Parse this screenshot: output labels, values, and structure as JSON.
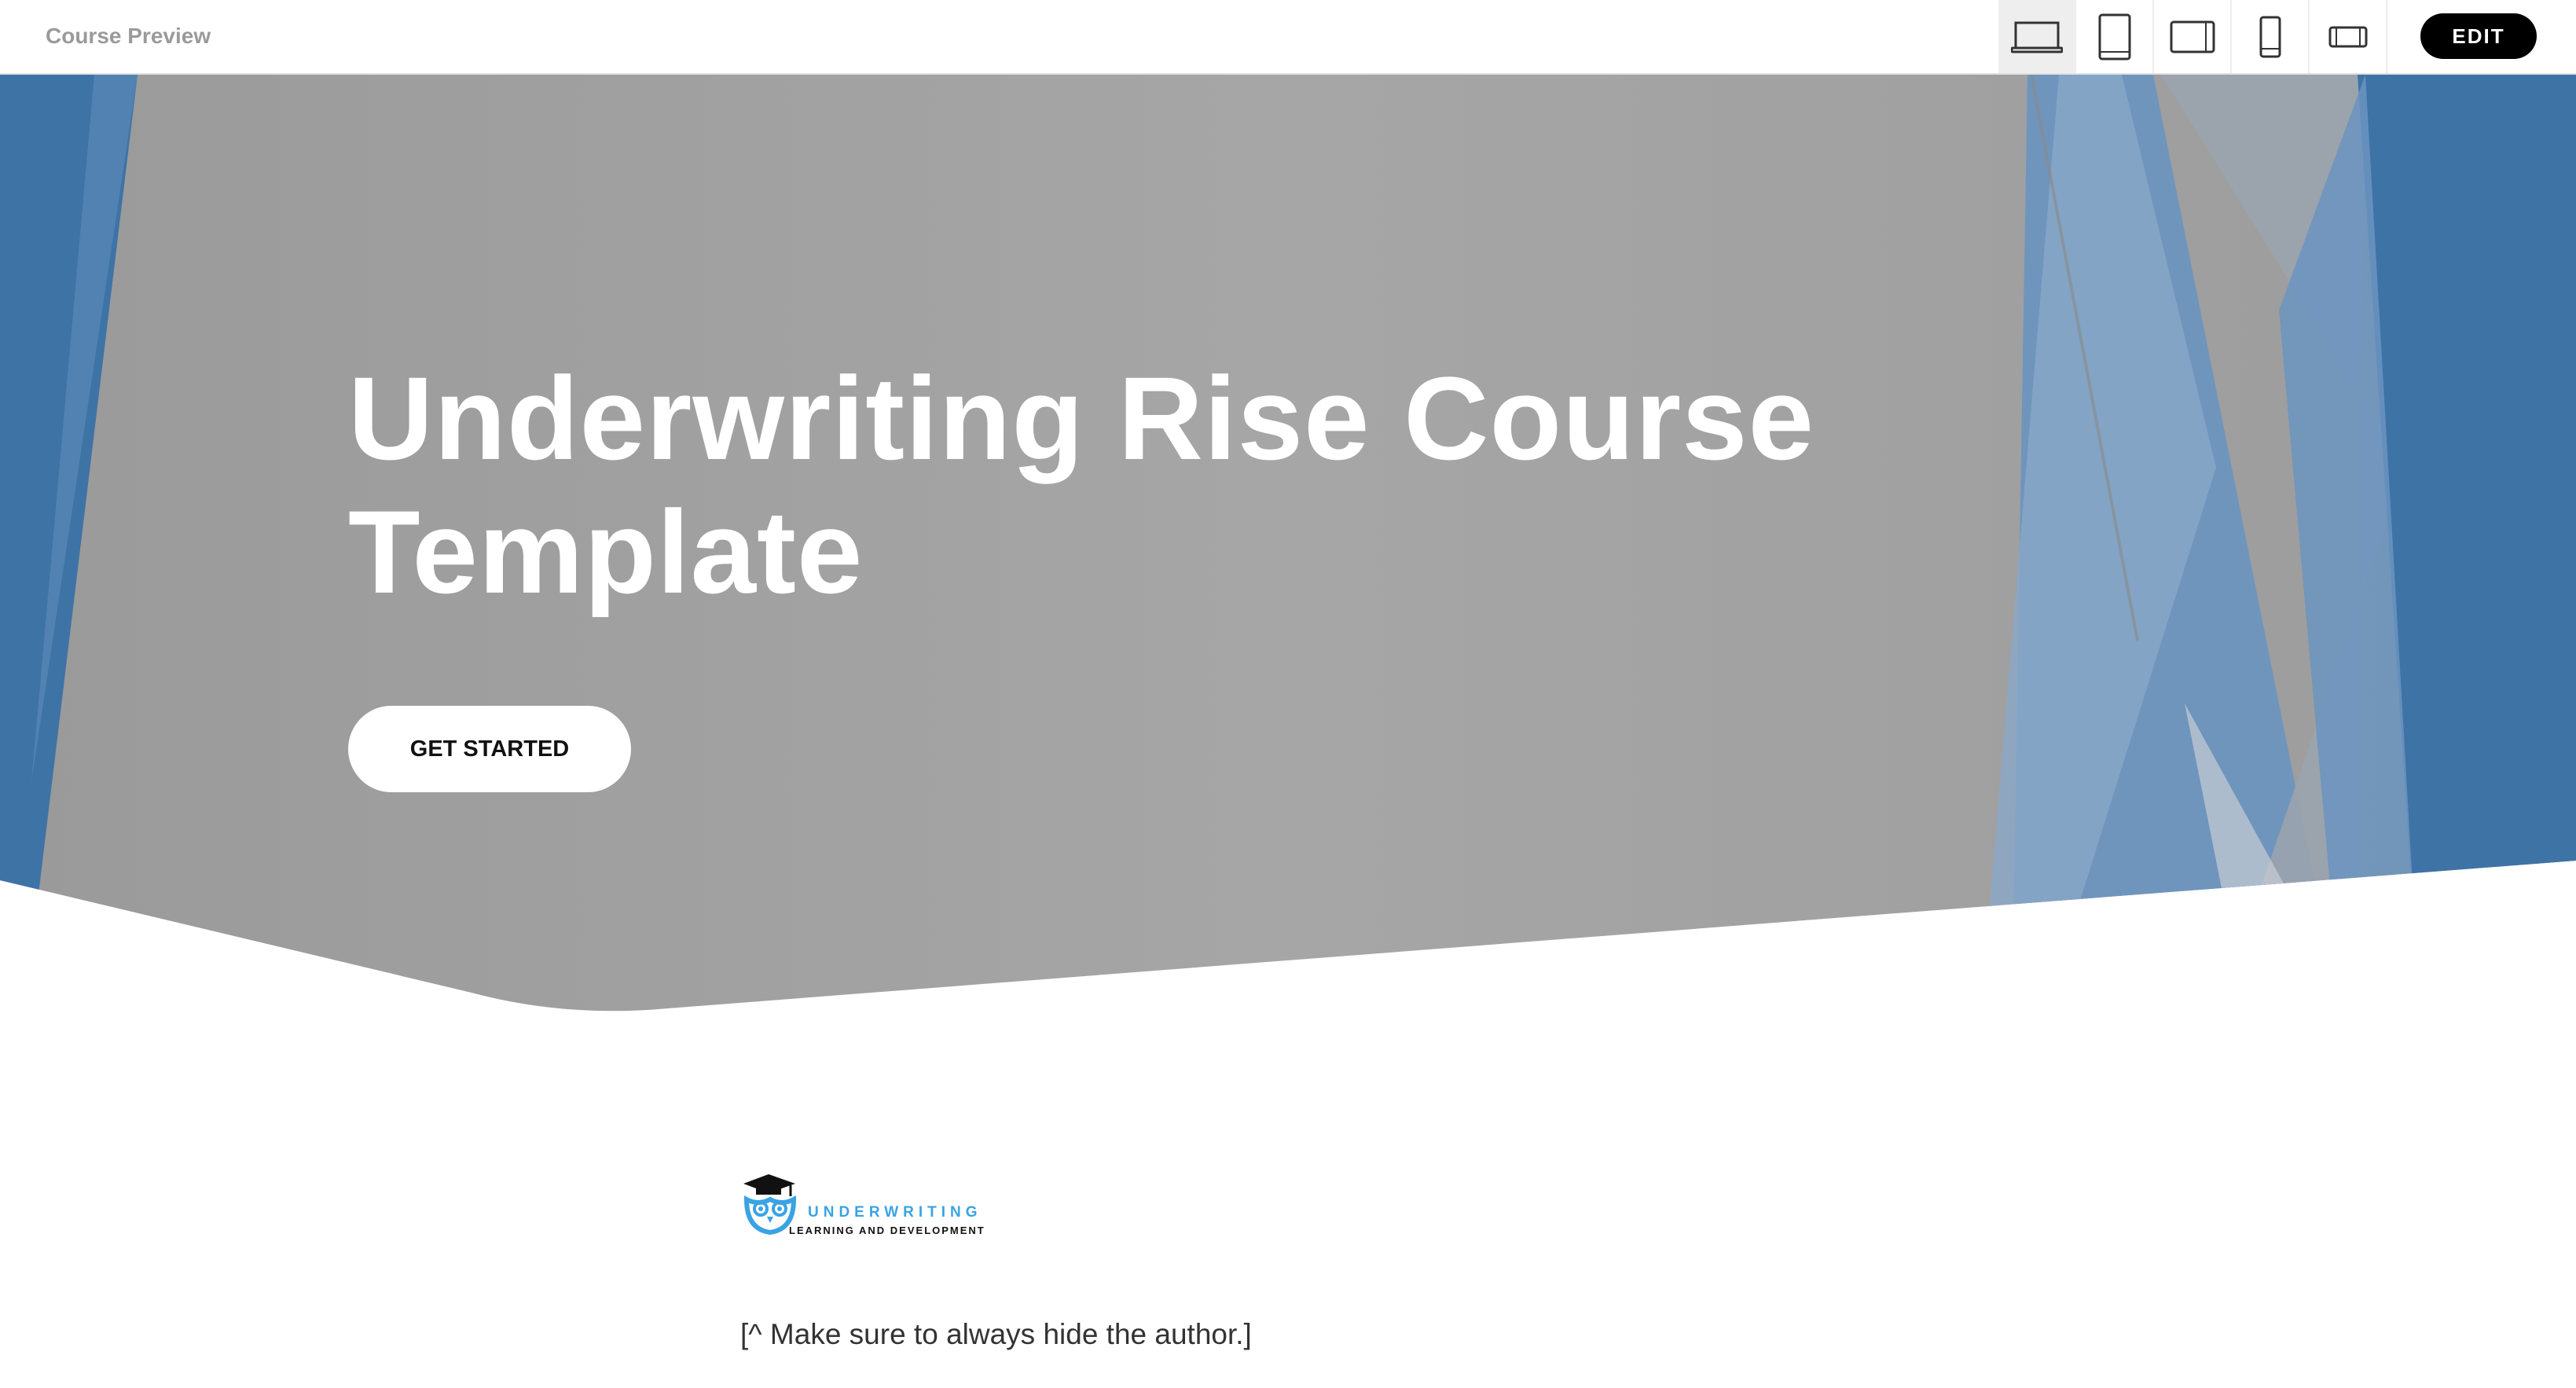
{
  "topbar": {
    "title": "Course Preview",
    "devices": [
      {
        "icon": "laptop-icon",
        "active": true
      },
      {
        "icon": "tablet-portrait-icon",
        "active": false
      },
      {
        "icon": "tablet-landscape-icon",
        "active": false
      },
      {
        "icon": "phone-portrait-icon",
        "active": false
      },
      {
        "icon": "phone-landscape-icon",
        "active": false
      }
    ],
    "edit_label": "EDIT"
  },
  "hero": {
    "title_line1": "Underwriting Rise Course",
    "title_line2": "Template",
    "cta_label": "GET STARTED",
    "colors": {
      "gray": "#a3a3a3",
      "blue": "#3e73a6",
      "light_blue": "#7fa6cf"
    }
  },
  "logo": {
    "word": "UNDERWRITING",
    "subtitle": "LEARNING AND DEVELOPMENT",
    "accent": "#3aa3e3"
  },
  "content": {
    "author_note": "[^ Make sure to always hide the author.]"
  }
}
